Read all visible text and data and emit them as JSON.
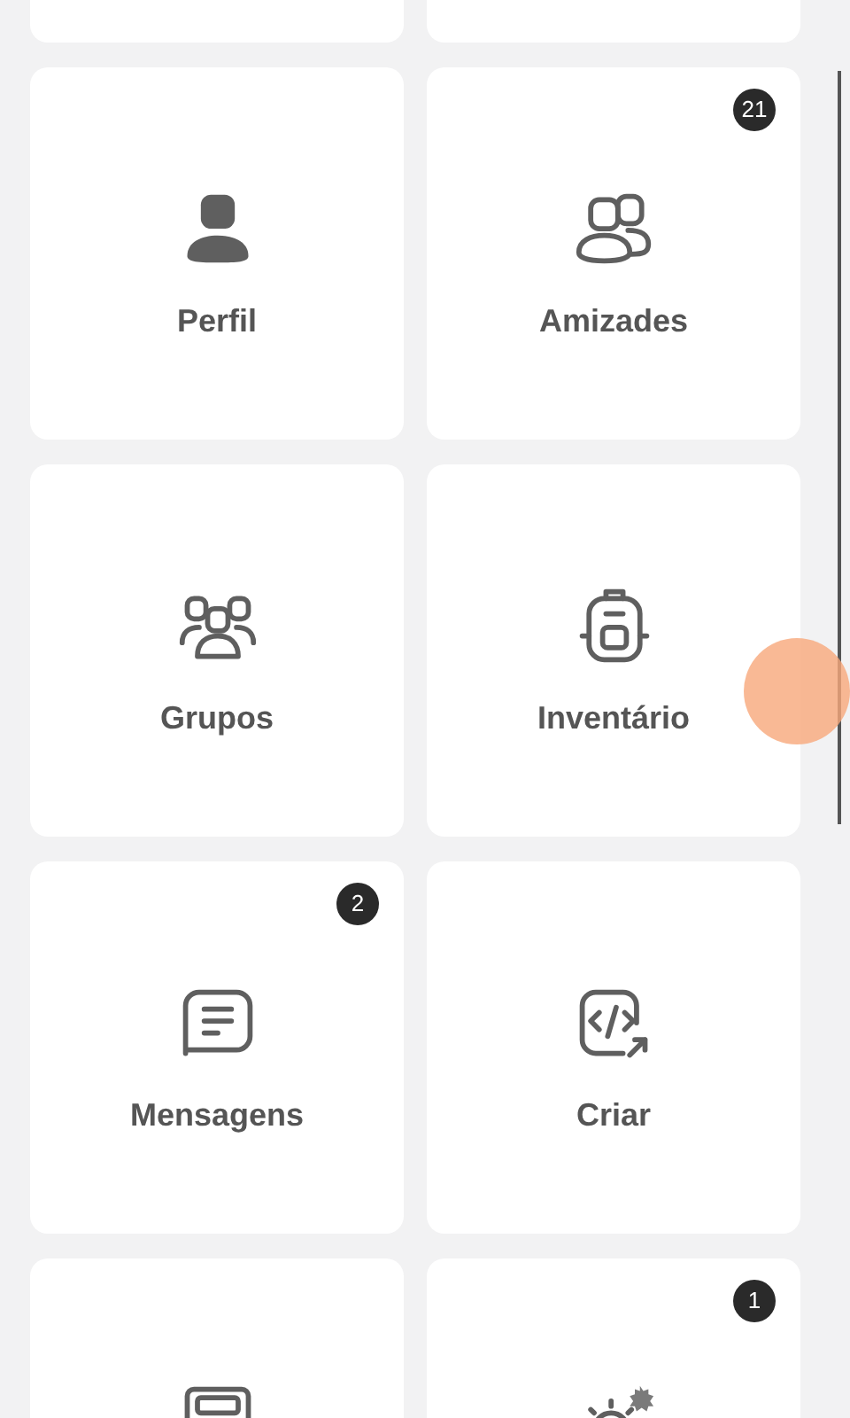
{
  "tiles": [
    {
      "kind": "profile",
      "label": "Perfil"
    },
    {
      "kind": "friends",
      "label": "Amizades",
      "badge": "21"
    },
    {
      "kind": "groups",
      "label": "Grupos"
    },
    {
      "kind": "inventory",
      "label": "Inventário"
    },
    {
      "kind": "messages",
      "label": "Mensagens",
      "badge": "2"
    },
    {
      "kind": "create",
      "label": "Criar"
    },
    {
      "kind": "screen"
    },
    {
      "kind": "settings",
      "badge": "1"
    }
  ]
}
